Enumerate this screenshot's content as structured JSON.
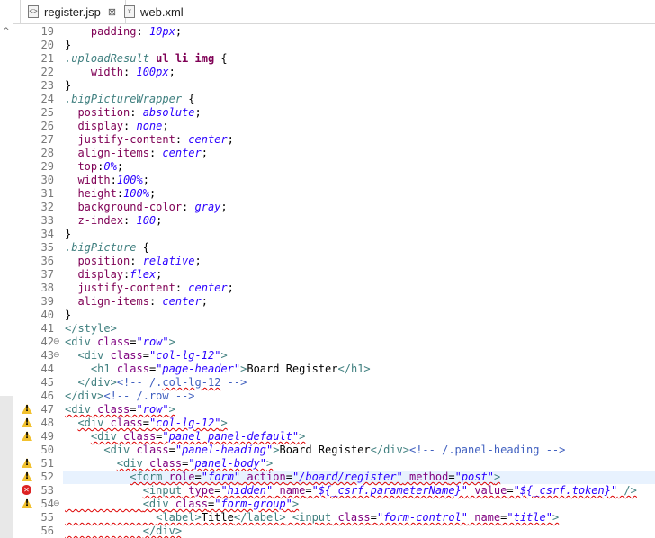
{
  "tabs": [
    {
      "label": "register.jsp",
      "active": true,
      "close": "⊠"
    },
    {
      "label": "web.xml",
      "active": false
    }
  ],
  "editor": {
    "lines": [
      {
        "n": "19",
        "html": "    <span class=\"prop\">padding</span>: <span class=\"val\">10px</span>;"
      },
      {
        "n": "20",
        "html": "}"
      },
      {
        "n": "21",
        "html": "<span class=\"sel\">.uploadResult</span> <span class=\"kw\">ul li img</span> {"
      },
      {
        "n": "22",
        "html": "    <span class=\"prop\">width</span>: <span class=\"val\">100px</span>;"
      },
      {
        "n": "23",
        "html": "}"
      },
      {
        "n": "24",
        "html": "<span class=\"sel\">.bigPictureWrapper</span> {"
      },
      {
        "n": "25",
        "html": "  <span class=\"prop\">position</span>: <span class=\"val\">absolute</span>;"
      },
      {
        "n": "26",
        "html": "  <span class=\"prop\">display</span>: <span class=\"val\">none</span>;"
      },
      {
        "n": "27",
        "html": "  <span class=\"prop\">justify-content</span>: <span class=\"val\">center</span>;"
      },
      {
        "n": "28",
        "html": "  <span class=\"prop\">align-items</span>: <span class=\"val\">center</span>;"
      },
      {
        "n": "29",
        "html": "  <span class=\"prop\">top</span>:<span class=\"val\">0%</span>;"
      },
      {
        "n": "30",
        "html": "  <span class=\"prop\">width</span>:<span class=\"val\">100%</span>;"
      },
      {
        "n": "31",
        "html": "  <span class=\"prop\">height</span>:<span class=\"val\">100%</span>;"
      },
      {
        "n": "32",
        "html": "  <span class=\"prop\">background-color</span>: <span class=\"val\">gray</span>;"
      },
      {
        "n": "33",
        "html": "  <span class=\"prop\">z-index</span>: <span class=\"val\">100</span>;"
      },
      {
        "n": "34",
        "html": "}"
      },
      {
        "n": "35",
        "html": "<span class=\"sel\">.bigPicture</span> {"
      },
      {
        "n": "36",
        "html": "  <span class=\"prop\">position</span>: <span class=\"val\">relative</span>;"
      },
      {
        "n": "37",
        "html": "  <span class=\"prop\">display</span>:<span class=\"val\">flex</span>;"
      },
      {
        "n": "38",
        "html": "  <span class=\"prop\">justify-content</span>: <span class=\"val\">center</span>;"
      },
      {
        "n": "39",
        "html": "  <span class=\"prop\">align-items</span>: <span class=\"val\">center</span>;"
      },
      {
        "n": "40",
        "html": "}"
      },
      {
        "n": "41",
        "html": "<span class=\"tag\">&lt;/style&gt;</span>"
      },
      {
        "n": "42",
        "fold": "⊖",
        "html": "<span class=\"tag\">&lt;div</span> <span class=\"attr\">class</span>=<span class=\"str\">\"row\"</span><span class=\"tag\">&gt;</span>"
      },
      {
        "n": "43",
        "fold": "⊖",
        "html": "  <span class=\"tag\">&lt;div</span> <span class=\"attr\">class</span>=<span class=\"str\">\"col-lg-12\"</span><span class=\"tag\">&gt;</span>"
      },
      {
        "n": "44",
        "html": "    <span class=\"tag\">&lt;h1</span> <span class=\"attr\">class</span>=<span class=\"str\">\"page-header\"</span><span class=\"tag\">&gt;</span>Board Register<span class=\"tag\">&lt;/h1&gt;</span>"
      },
      {
        "n": "45",
        "html": "  <span class=\"tag\">&lt;/div&gt;</span><span class=\"cmt\">&lt;!-- /.<span class=\"squig\">col-lg-12</span> --&gt;</span>"
      },
      {
        "n": "46",
        "html": "<span class=\"tag\">&lt;/div&gt;</span><span class=\"cmt\">&lt;!-- /.row --&gt;</span>"
      },
      {
        "n": "47",
        "mark": "warn",
        "html": "<span class=\"squig\"><span class=\"tag\">&lt;div</span> <span class=\"attr\">class</span>=<span class=\"str\">\"row\"</span><span class=\"tag\">&gt;</span></span>"
      },
      {
        "n": "48",
        "mark": "warn",
        "html": "  <span class=\"squig\"><span class=\"tag\">&lt;div</span> <span class=\"attr\">class</span>=<span class=\"str\">\"col-lg-12\"</span><span class=\"tag\">&gt;</span></span>"
      },
      {
        "n": "49",
        "mark": "warn",
        "html": "    <span class=\"squig\"><span class=\"tag\">&lt;div</span> <span class=\"attr\">class</span>=<span class=\"str\">\"panel panel-default\"</span><span class=\"tag\">&gt;</span></span>"
      },
      {
        "n": "50",
        "html": "      <span class=\"tag\">&lt;div</span> <span class=\"attr\">class</span>=<span class=\"str\">\"panel-heading\"</span><span class=\"tag\">&gt;</span>Board Register<span class=\"tag\">&lt;/div&gt;</span><span class=\"cmt\">&lt;!-- /.panel-heading --&gt;</span>"
      },
      {
        "n": "51",
        "mark": "warn",
        "html": "        <span class=\"squig\"><span class=\"tag\">&lt;div</span> <span class=\"attr\">class</span>=<span class=\"str\">\"panel-body\"</span><span class=\"tag\">&gt;</span></span>"
      },
      {
        "n": "52",
        "mark": "warn",
        "hl": true,
        "html": "          <span class=\"squig\"><span class=\"tag\">&lt;form</span> <span class=\"attr\">role</span>=<span class=\"str\">\"form\"</span> <span class=\"attr\">action</span>=<span class=\"str\">\"/board/register\"</span> <span class=\"attr\">method</span>=<span class=\"str\">\"post\"</span><span class=\"tag\">&gt;</span></span>"
      },
      {
        "n": "53",
        "mark": "err",
        "html": "            <span class=\"squig\"><span class=\"tag\">&lt;input</span> <span class=\"attr\">type</span>=<span class=\"str\">\"hidden\"</span> <span class=\"attr\">name</span>=<span class=\"str\">\"${_csrf.parameterName}\"</span> <span class=\"attr\">value</span>=<span class=\"str\">\"${_csrf.token}\"</span> <span class=\"tag\">/&gt;</span></span>"
      },
      {
        "n": "54",
        "mark": "warn",
        "fold": "⊖",
        "html": "<span class=\"squig\">            <span class=\"tag\">&lt;div</span> <span class=\"attr\">class</span>=<span class=\"str\">\"form-group\"</span><span class=\"tag\">&gt;</span></span>"
      },
      {
        "n": "55",
        "html": "<span class=\"squig\">              <span class=\"tag\">&lt;label&gt;</span>Title<span class=\"tag\">&lt;/label&gt;</span> <span class=\"tag\">&lt;input</span> <span class=\"attr\">class</span>=<span class=\"str\">\"form-control\"</span> <span class=\"attr\">name</span>=<span class=\"str\">\"title\"</span><span class=\"tag\">&gt;</span></span>"
      },
      {
        "n": "56",
        "html": "<span class=\"squig\">            <span class=\"tag\">&lt;/div&gt;</span></span>"
      }
    ]
  }
}
